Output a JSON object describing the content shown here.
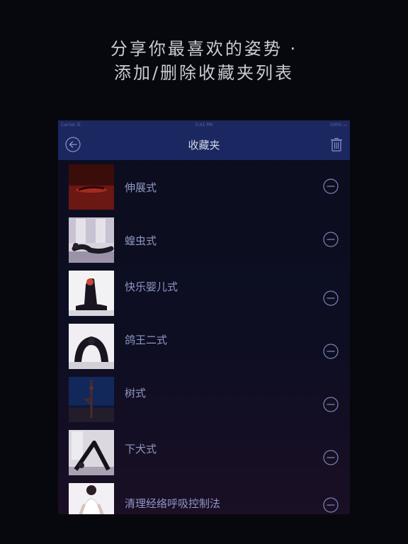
{
  "promo": {
    "line1": "分享你最喜欢的姿势 ·",
    "line2": "添加/删除收藏夹列表"
  },
  "statusbar": {
    "carrier": "Carrier ☰",
    "time": "5:01 PM",
    "battery": "100%  ▭"
  },
  "navbar": {
    "title": "收藏夹",
    "back_icon": "back-arrow-circle-icon",
    "delete_icon": "trash-icon"
  },
  "favorites": [
    {
      "name": "伸展式",
      "thumb": "stretch-pose-thumbnail"
    },
    {
      "name": "蝗虫式",
      "thumb": "locust-pose-thumbnail"
    },
    {
      "name": "快乐婴儿式",
      "thumb": "happy-baby-pose-thumbnail"
    },
    {
      "name": "鸽王二式",
      "thumb": "king-pigeon-pose-thumbnail"
    },
    {
      "name": "树式",
      "thumb": "tree-pose-thumbnail"
    },
    {
      "name": "下犬式",
      "thumb": "downward-dog-pose-thumbnail"
    },
    {
      "name": "清理经络呼吸控制法",
      "thumb": "breathing-pose-thumbnail"
    }
  ],
  "colors": {
    "background": "#07080d",
    "navbar": "#1b2761",
    "row_text": "#8f96c4",
    "icon": "#7d84b8"
  }
}
